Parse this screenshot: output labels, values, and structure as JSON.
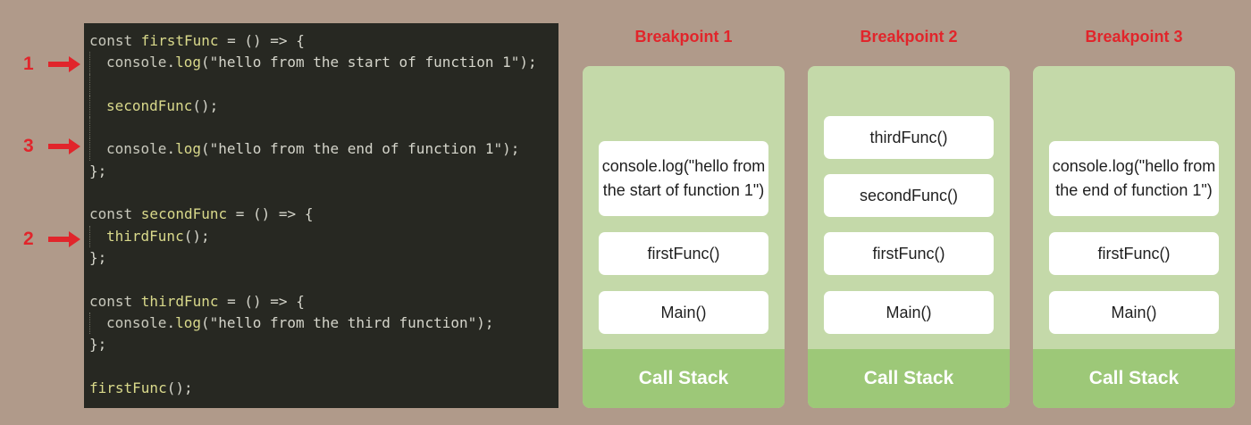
{
  "markers": [
    "1",
    "3",
    "2"
  ],
  "code_lines": [
    {
      "kw": "const ",
      "fn": "firstFunc",
      "rest": " = () => {",
      "indent": false
    },
    {
      "kw": "",
      "fn": "console",
      "rest": ".log(\"hello from the start of function 1\");",
      "indent": true,
      "fn_is_obj": true
    },
    {
      "kw": "",
      "fn": "",
      "rest": "",
      "indent": true
    },
    {
      "kw": "",
      "fn": "secondFunc",
      "rest": "();",
      "indent": true
    },
    {
      "kw": "",
      "fn": "",
      "rest": "",
      "indent": true
    },
    {
      "kw": "",
      "fn": "console",
      "rest": ".log(\"hello from the end of function 1\");",
      "indent": true,
      "fn_is_obj": true
    },
    {
      "kw": "",
      "fn": "",
      "rest": "};",
      "indent": false
    },
    {
      "kw": "",
      "fn": "",
      "rest": "",
      "indent": false
    },
    {
      "kw": "const ",
      "fn": "secondFunc",
      "rest": " = () => {",
      "indent": false
    },
    {
      "kw": "",
      "fn": "thirdFunc",
      "rest": "();",
      "indent": true
    },
    {
      "kw": "",
      "fn": "",
      "rest": "};",
      "indent": false
    },
    {
      "kw": "",
      "fn": "",
      "rest": "",
      "indent": false
    },
    {
      "kw": "const ",
      "fn": "thirdFunc",
      "rest": " = () => {",
      "indent": false
    },
    {
      "kw": "",
      "fn": "console",
      "rest": ".log(\"hello from the third function\");",
      "indent": true,
      "fn_is_obj": true
    },
    {
      "kw": "",
      "fn": "",
      "rest": "};",
      "indent": false
    },
    {
      "kw": "",
      "fn": "",
      "rest": "",
      "indent": false
    },
    {
      "kw": "",
      "fn": "firstFunc",
      "rest": "();",
      "indent": false
    }
  ],
  "breakpoints": [
    {
      "title": "Breakpoint 1",
      "frames": [
        "console.log(\"hello from the start of function 1\")",
        "firstFunc()",
        "Main()"
      ],
      "footer": "Call Stack"
    },
    {
      "title": "Breakpoint 2",
      "frames": [
        "thirdFunc()",
        "secondFunc()",
        "firstFunc()",
        "Main()"
      ],
      "footer": "Call Stack"
    },
    {
      "title": "Breakpoint 3",
      "frames": [
        "console.log(\"hello from the end of function 1\")",
        "firstFunc()",
        "Main()"
      ],
      "footer": "Call Stack"
    }
  ],
  "colors": {
    "background": "#b09a8a",
    "code_bg": "#272822",
    "accent_red": "#e1252b",
    "stack_bg": "#c4d9a9",
    "stack_footer": "#9dc878"
  }
}
